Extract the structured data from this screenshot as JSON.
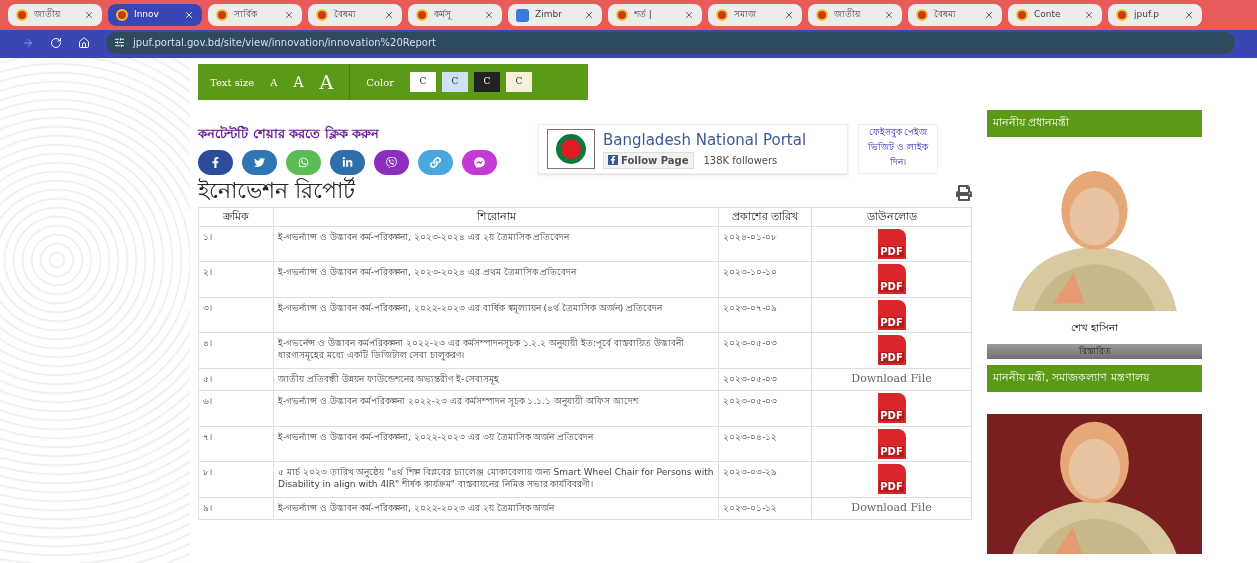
{
  "browser": {
    "tabs": [
      {
        "title": "জাতীয়",
        "selected": false,
        "kind": "site"
      },
      {
        "title": "Innov",
        "selected": true,
        "kind": "site"
      },
      {
        "title": "সার্বিক",
        "selected": false,
        "kind": "site"
      },
      {
        "title": "বৈষম্য",
        "selected": false,
        "kind": "site"
      },
      {
        "title": "কর্মসূ",
        "selected": false,
        "kind": "site"
      },
      {
        "title": "Zimbr",
        "selected": false,
        "kind": "mail"
      },
      {
        "title": "শর্ত |",
        "selected": false,
        "kind": "site"
      },
      {
        "title": "সমাজ",
        "selected": false,
        "kind": "site"
      },
      {
        "title": "জাতীয়",
        "selected": false,
        "kind": "site"
      },
      {
        "title": "বৈষম্য",
        "selected": false,
        "kind": "site"
      },
      {
        "title": "Conte",
        "selected": false,
        "kind": "site"
      },
      {
        "title": "jpuf.p",
        "selected": false,
        "kind": "site"
      }
    ],
    "url": "jpuf.portal.gov.bd/site/view/innovation/innovation%20Report"
  },
  "accessibility": {
    "text_size_label": "Text size",
    "sizes": [
      "A",
      "A",
      "A"
    ],
    "color_label": "Color",
    "colors": [
      {
        "label": "C",
        "color": "#ffffff"
      },
      {
        "label": "C",
        "color": "#cfe2f3"
      },
      {
        "label": "C",
        "color": "#222222"
      },
      {
        "label": "C",
        "color": "#f5f0dc"
      }
    ]
  },
  "share": {
    "title": "কনটেন্টটি শেয়ার করতে ক্লিক করুন",
    "buttons": [
      {
        "kind": "facebook",
        "color": "#2b4c9b"
      },
      {
        "kind": "twitter",
        "color": "#2f75b5"
      },
      {
        "kind": "whatsapp",
        "color": "#5dbb55"
      },
      {
        "kind": "linkedin",
        "color": "#2f6fa8"
      },
      {
        "kind": "viber",
        "color": "#8c2fc0"
      },
      {
        "kind": "link",
        "color": "#4aa8e0"
      },
      {
        "kind": "messenger",
        "color": "#c33ad6"
      }
    ]
  },
  "facebook_box": {
    "title": "Bangladesh National Portal",
    "follow": "Follow Page",
    "followers": "138K followers"
  },
  "facebook_note": "ফেইসবুক পেইজ ভিজিট ও লাইক দিন।",
  "heading": "ইনোভেশন রিপোর্ট",
  "table": {
    "columns": [
      "ক্রমিক",
      "শিরোনাম",
      "প্রকাশের তারিখ",
      "ডাউনলোড"
    ],
    "rows": [
      {
        "serial": "১।",
        "title": "ই-গভর্ন্যান্স ও উদ্ভাবন কর্ম-পরিকল্পনা, ২০২৩-২০২৪ এর ২য় ত্রৈমাসিক প্রতিবেদন",
        "date": "২০২৪-০১-০৮",
        "download": {
          "kind": "pdf",
          "label": "PDF"
        }
      },
      {
        "serial": "২।",
        "title": "ই-গভর্ন্যান্স ও উদ্ভাবন কর্ম-পরিকল্পনা, ২০২৩-২০২৪ এর প্রথম ত্রৈমাসিক প্রতিবেদন",
        "date": "২০২৩-১০-১০",
        "download": {
          "kind": "pdf",
          "label": "PDF"
        }
      },
      {
        "serial": "৩।",
        "title": "ই-গভর্ন্যান্স ও উদ্ভাবন কর্ম-পরিকল্পনা, ২০২২-২০২৩ এর বার্ষিক স্বমূল্যায়ন (৪র্থ ত্রৈমাসিক অর্জন) প্রতিবেদন",
        "date": "২০২৩-০৭-০৯",
        "download": {
          "kind": "pdf",
          "label": "PDF"
        }
      },
      {
        "serial": "৪।",
        "title": "ই-গভর্নেন্স ও উদ্ভাবন কর্মপরিকল্পনা ২০২২-২৩ এর কর্মসম্পাদনসূচক ১.২.২ অনুযায়ী ইত:পূর্বে বাস্তবায়িত উদ্ভাবনী ধারণাসমূহের মধ্যে একটি ডিজিটাল সেবা চালুকরণ।",
        "date": "২০২৩-০৫-০৩",
        "download": {
          "kind": "pdf",
          "label": "PDF"
        }
      },
      {
        "serial": "৫।",
        "title": "জাতীয় প্রতিবন্ধী উন্নয়ন ফাউন্ডেশনের অভ্যন্তরীণ ই-সেবাসমূহ",
        "date": "২০২৩-০৫-০৩",
        "download": {
          "kind": "link",
          "label": "Download File"
        }
      },
      {
        "serial": "৬।",
        "title": "ই-গভর্ন্যান্স ও উদ্ভাবন কর্মপরিকল্পনা ২০২২-২৩ এর কর্মসম্পাদন সূচক ১.১.১ অনুযায়ী অফিস আদেশ",
        "date": "২০২৩-০৫-০৩",
        "download": {
          "kind": "pdf",
          "label": "PDF"
        }
      },
      {
        "serial": "৭।",
        "title": "ই-গভর্ন্যান্স ও উদ্ভাবন কর্ম-পরিকল্পনা, ২০২২-২০২৩ এর ৩য় ত্রৈমাসিক অর্জন প্রতিবেদন",
        "date": "২০২৩-০৪-১২",
        "download": {
          "kind": "pdf",
          "label": "PDF"
        }
      },
      {
        "serial": "৮।",
        "title": "৫ মার্চ ২০২৩ তারিখ অনুষ্ঠেয় \"৪র্থ শিল্প বিপ্লবের চ্যালেঞ্জ মোকাবেলায় জন্য Smart Wheel Chair for Persons with Disability in align with 4IR\" শীর্ষক কার্যক্রম\" বাস্তবায়নের নিমিত্ত সভার কার্যবিবরণী।",
        "date": "২০২৩-০৩-২৯",
        "download": {
          "kind": "pdf",
          "label": "PDF"
        }
      },
      {
        "serial": "৯।",
        "title": "ই-গভর্ন্যান্স ও উদ্ভাবন কর্ম-পরিকল্পনা, ২০২২-২০২৩ এর ২য় ত্রৈমাসিক অর্জন",
        "date": "২০২৩-০১-১২",
        "download": {
          "kind": "link",
          "label": "Download File"
        }
      }
    ]
  },
  "sidebar": {
    "pm_title": "মাননীয় প্রধানমন্ত্রী",
    "pm_name": "শেখ হাসিনা",
    "details": "বিস্তারিত",
    "minister_title": "মাননীয় মন্ত্রী, সমাজকল্যাণ মন্ত্রণালয়"
  }
}
